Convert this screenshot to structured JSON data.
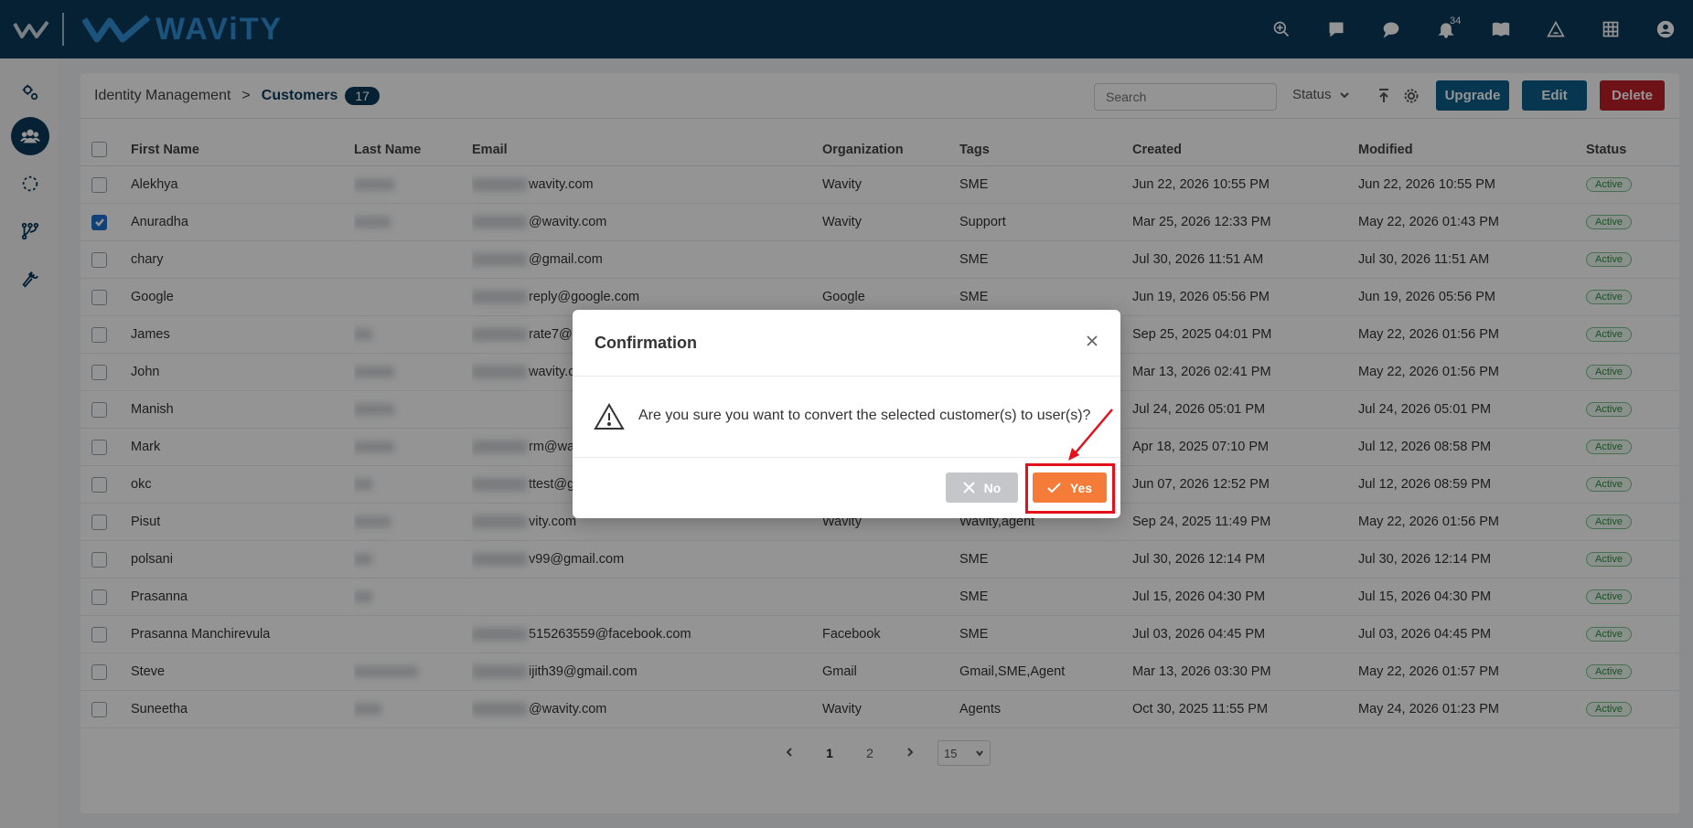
{
  "brand": {
    "name": "WAViTY"
  },
  "topbar": {
    "icons": [
      "search-network-icon",
      "chat-square-icon",
      "chat-bubble-icon",
      "bell-icon",
      "book-icon",
      "warning-triangle-icon",
      "grid-icon",
      "user-circle-icon"
    ],
    "notification_count": "34"
  },
  "sidebar": {
    "items": [
      "settings-gears-icon",
      "customers-icon",
      "loading-circle-icon",
      "workflow-icon",
      "wrench-icon"
    ],
    "active_index": 1
  },
  "header": {
    "breadcrumb_root": "Identity Management",
    "breadcrumb_sep": ">",
    "breadcrumb_current": "Customers",
    "count": "17",
    "search_placeholder": "Search",
    "status_filter": "Status",
    "upgrade_label": "Upgrade",
    "edit_label": "Edit",
    "delete_label": "Delete"
  },
  "table": {
    "columns": [
      "First Name",
      "Last Name",
      "Email",
      "Organization",
      "Tags",
      "Created",
      "Modified",
      "Status"
    ],
    "rows": [
      {
        "checked": false,
        "first": "Alekhya",
        "email_visible": "wavity.com",
        "org": "Wavity",
        "tags": "SME",
        "created": "Jun 22, 2026 10:55 PM",
        "modified": "Jun 22, 2026 10:55 PM",
        "status": "Active"
      },
      {
        "checked": true,
        "first": "Anuradha",
        "email_visible": "@wavity.com",
        "org": "Wavity",
        "tags": "Support",
        "created": "Mar 25, 2026 12:33 PM",
        "modified": "May 22, 2026 01:43 PM",
        "status": "Active"
      },
      {
        "checked": false,
        "first": "chary",
        "email_visible": "@gmail.com",
        "org": "",
        "tags": "SME",
        "created": "Jul 30, 2026 11:51 AM",
        "modified": "Jul 30, 2026 11:51 AM",
        "status": "Active"
      },
      {
        "checked": false,
        "first": "Google",
        "email_visible": "reply@google.com",
        "org": "Google",
        "tags": "SME",
        "created": "Jun 19, 2026 05:56 PM",
        "modified": "Jun 19, 2026 05:56 PM",
        "status": "Active"
      },
      {
        "checked": false,
        "first": "James",
        "email_visible": "rate7@",
        "org": "",
        "tags": "",
        "created": "Sep 25, 2025 04:01 PM",
        "modified": "May 22, 2026 01:56 PM",
        "status": "Active"
      },
      {
        "checked": false,
        "first": "John",
        "email_visible": "wavity.c",
        "org": "",
        "tags": "",
        "created": "Mar 13, 2026 02:41 PM",
        "modified": "May 22, 2026 01:56 PM",
        "status": "Active"
      },
      {
        "checked": false,
        "first": "Manish",
        "email_visible": "",
        "org": "",
        "tags": "",
        "created": "Jul 24, 2026 05:01 PM",
        "modified": "Jul 24, 2026 05:01 PM",
        "status": "Active"
      },
      {
        "checked": false,
        "first": "Mark",
        "email_visible": "rm@wa",
        "org": "",
        "tags": "",
        "created": "Apr 18, 2025 07:10 PM",
        "modified": "Jul 12, 2026 08:58 PM",
        "status": "Active"
      },
      {
        "checked": false,
        "first": "okc",
        "email_visible": "ttest@g",
        "org": "",
        "tags": "",
        "created": "Jun 07, 2026 12:52 PM",
        "modified": "Jul 12, 2026 08:59 PM",
        "status": "Active"
      },
      {
        "checked": false,
        "first": "Pisut",
        "email_visible": "vity.com",
        "org": "Wavity",
        "tags": "Wavity,agent",
        "created": "Sep 24, 2025 11:49 PM",
        "modified": "May 22, 2026 01:56 PM",
        "status": "Active"
      },
      {
        "checked": false,
        "first": "polsani",
        "email_visible": "v99@gmail.com",
        "org": "",
        "tags": "SME",
        "created": "Jul 30, 2026 12:14 PM",
        "modified": "Jul 30, 2026 12:14 PM",
        "status": "Active"
      },
      {
        "checked": false,
        "first": "Prasanna",
        "email_visible": "",
        "org": "",
        "tags": "SME",
        "created": "Jul 15, 2026 04:30 PM",
        "modified": "Jul 15, 2026 04:30 PM",
        "status": "Active"
      },
      {
        "checked": false,
        "first": "Prasanna Manchirevula",
        "email_visible": "515263559@facebook.com",
        "org": "Facebook",
        "tags": "SME",
        "created": "Jul 03, 2026 04:45 PM",
        "modified": "Jul 03, 2026 04:45 PM",
        "status": "Active"
      },
      {
        "checked": false,
        "first": "Steve",
        "email_visible": "ijith39@gmail.com",
        "org": "Gmail",
        "tags": "Gmail,SME,Agent",
        "created": "Mar 13, 2026 03:30 PM",
        "modified": "May 22, 2026 01:57 PM",
        "status": "Active"
      },
      {
        "checked": false,
        "first": "Suneetha",
        "email_visible": "@wavity.com",
        "org": "Wavity",
        "tags": "Agents",
        "created": "Oct 30, 2025 11:55 PM",
        "modified": "May 24, 2026 01:23 PM",
        "status": "Active"
      }
    ]
  },
  "pagination": {
    "pages": [
      "1",
      "2"
    ],
    "current": "1",
    "page_size": "15"
  },
  "modal": {
    "title": "Confirmation",
    "message": "Are you sure you want to convert the selected customer(s) to user(s)?",
    "no_label": "No",
    "yes_label": "Yes"
  },
  "colors": {
    "topbar": "#0b3a5b",
    "brand_blue": "#2f8fd6",
    "primary_button": "#0d5d8c",
    "delete_button": "#c0202a",
    "yes_button": "#f57c38",
    "no_button": "#c4c6c9",
    "annotation_red": "#e3101b",
    "status_active": "#2e8b3e"
  }
}
